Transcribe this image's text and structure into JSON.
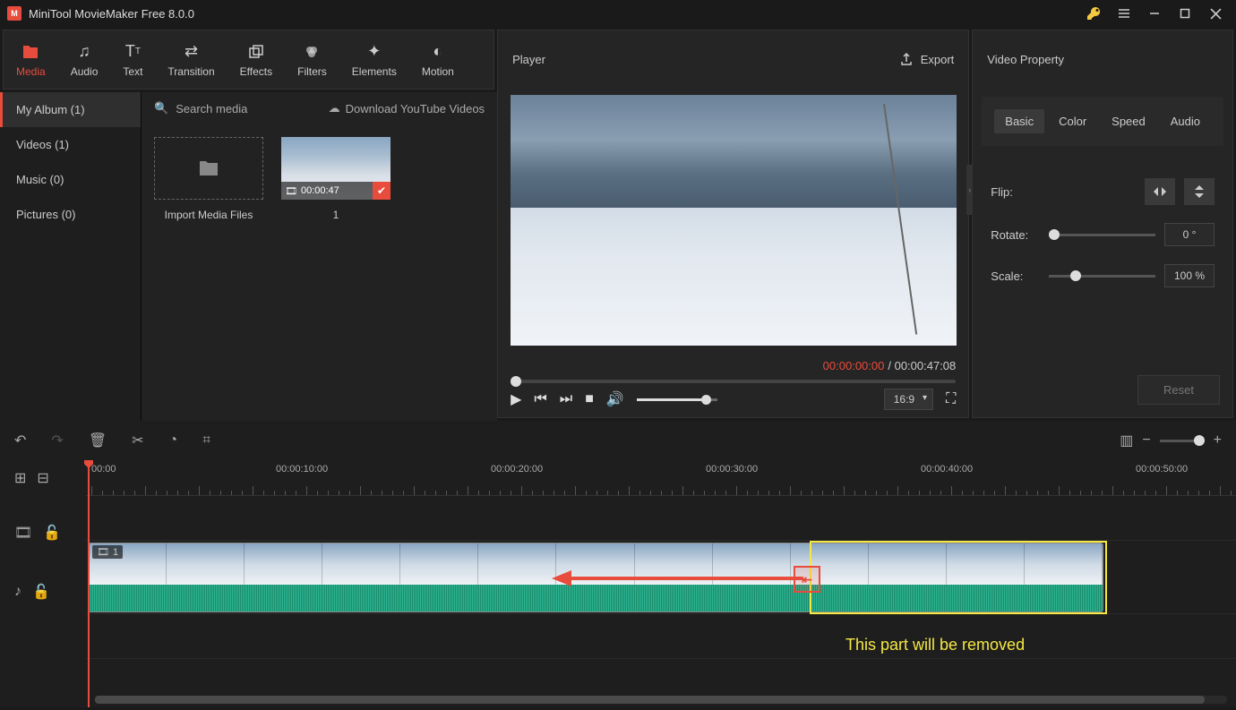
{
  "titlebar": {
    "title": "MiniTool MovieMaker Free 8.0.0"
  },
  "toolbar": {
    "media": "Media",
    "audio": "Audio",
    "text": "Text",
    "transition": "Transition",
    "effects": "Effects",
    "filters": "Filters",
    "elements": "Elements",
    "motion": "Motion"
  },
  "sidebar": {
    "myalbum": "My Album (1)",
    "videos": "Videos (1)",
    "music": "Music (0)",
    "pictures": "Pictures (0)"
  },
  "content": {
    "search_placeholder": "Search media",
    "download_link": "Download YouTube Videos",
    "import_label": "Import Media Files",
    "clip_duration": "00:00:47",
    "clip_index": "1"
  },
  "player": {
    "title": "Player",
    "export": "Export",
    "current": "00:00:00:00",
    "sep": " / ",
    "total": "00:00:47:08",
    "aspect": "16:9"
  },
  "props": {
    "title": "Video Property",
    "tab_basic": "Basic",
    "tab_color": "Color",
    "tab_speed": "Speed",
    "tab_audio": "Audio",
    "flip": "Flip:",
    "rotate": "Rotate:",
    "rotate_val": "0 °",
    "scale": "Scale:",
    "scale_val": "100 %",
    "reset": "Reset"
  },
  "timeline": {
    "marks": [
      "00:00",
      "00:00:10:00",
      "00:00:20:00",
      "00:00:30:00",
      "00:00:40:00",
      "00:00:50:00"
    ],
    "clip_index": "1",
    "annotation": "This part will be removed"
  }
}
